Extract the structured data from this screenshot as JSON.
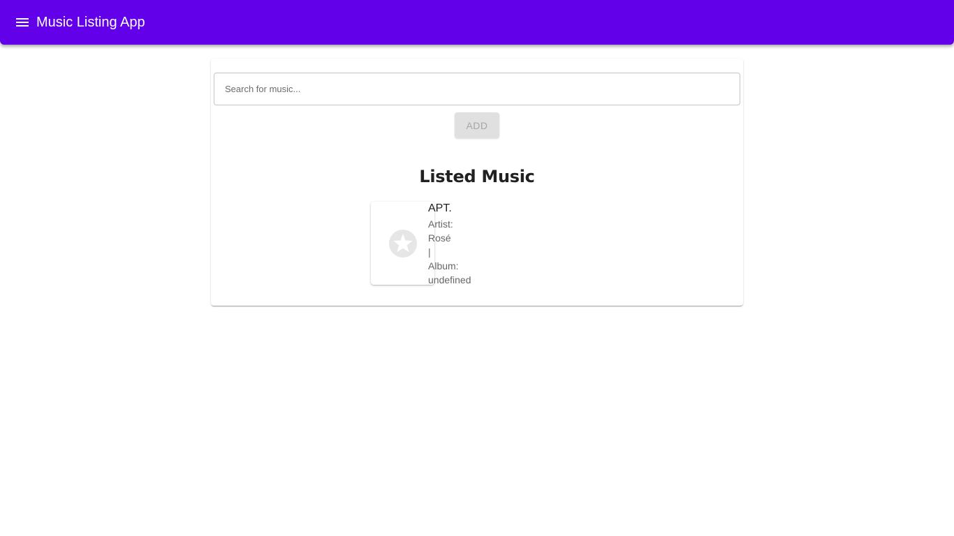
{
  "appbar": {
    "title": "Music Listing App",
    "menu_icon": "menu-icon",
    "color": "#6200ea"
  },
  "search": {
    "placeholder": "Search for music...",
    "value": ""
  },
  "add_button": {
    "label": "ADD",
    "disabled": true
  },
  "listed": {
    "heading": "Listed Music",
    "items": [
      {
        "title": "APT.",
        "artist_label": "Artist:",
        "artist": "Rosé",
        "separator": "|",
        "album_label": "Album:",
        "album": "undefined",
        "thumbnail_icon": "star-placeholder-icon"
      }
    ]
  }
}
